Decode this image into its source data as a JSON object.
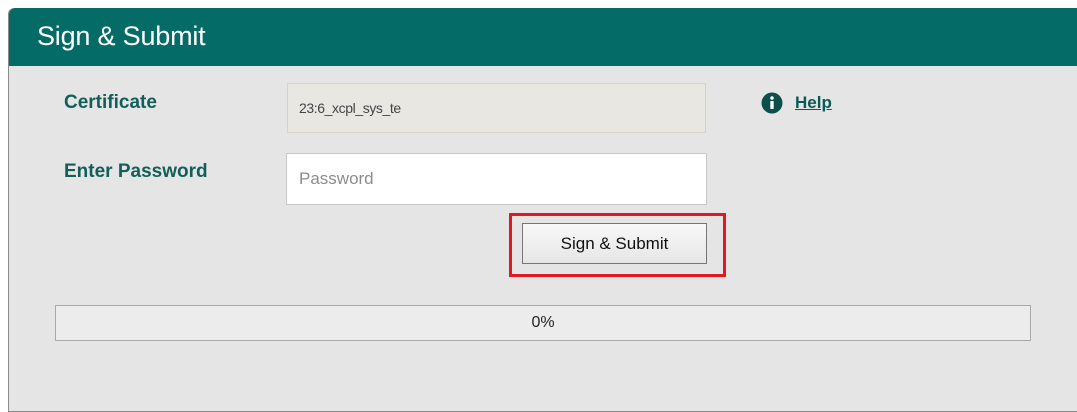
{
  "panel": {
    "title": "Sign & Submit"
  },
  "certificate": {
    "label": "Certificate",
    "value": "23:6_xcpl_sys_te"
  },
  "password": {
    "label": "Enter Password",
    "placeholder": "Password",
    "value": ""
  },
  "help": {
    "icon": "info-icon",
    "label": "Help"
  },
  "submit": {
    "label": "Sign & Submit",
    "highlighted": true,
    "highlight_color": "#e11a22"
  },
  "progress": {
    "fraction": 0,
    "label": "0%"
  },
  "colors": {
    "header": "#046b66",
    "label": "#125f59",
    "background": "#e5e5e5"
  }
}
